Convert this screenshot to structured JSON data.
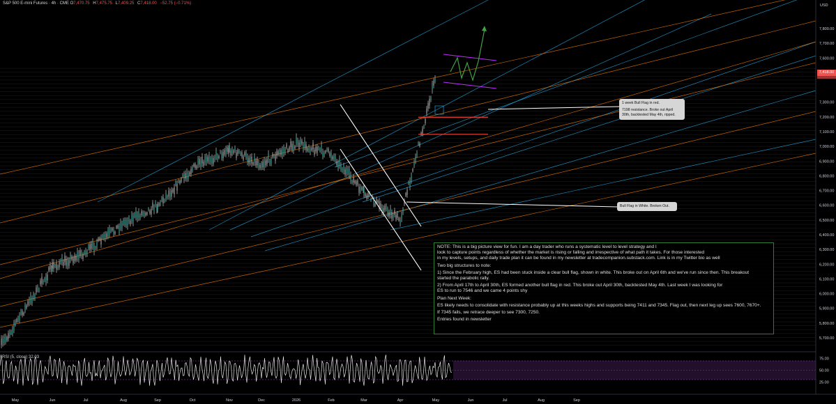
{
  "header": {
    "symbol": "S&P 500 E-mini Futures · 4h · CME",
    "o_label": "O",
    "o": "7,470.75",
    "h_label": "H",
    "h": "7,475.75",
    "l_label": "L",
    "l": "7,409.25",
    "c_label": "C",
    "c": "7,418.00",
    "chg": "−52.75 (−0.71%)"
  },
  "axis_currency": "USD",
  "price_tag": "7,418.00",
  "colors": {
    "background": "#000000",
    "candles": "#9e9e9e",
    "support_lines_orange": "#f57c00",
    "channel_lines_blue": "#29b6f6",
    "bull_flag_white": "#ffffff",
    "bull_flag_red": "#f44336",
    "projection_green": "#43a047",
    "flag_purple": "#c02bff",
    "rsi_band": "#5e2a7e",
    "negative": "#ef5350"
  },
  "callouts": {
    "red_flag": {
      "line1": "1 week Bull Flag in red.",
      "line2": "7198 resistance. Broke out April 30th, backtested May 4th, ripped."
    },
    "white_flag": {
      "line1": "Bull Flag in White. Broken Out."
    }
  },
  "note": {
    "p1": "NOTE: This is a big picture view for fun. I am a day trader who runs a systematic level to level strategy and I\nlook to capture points regardless of whether the market is rising or falling and irrespective of what path it takes. For those interested\nin my levels, setups, and daily trade plan it can be found in my newsletter at tradecompanion.substack.com. Link is in my Twitter bio as well",
    "p2": "Two big structures to note:",
    "p3": "1) Since the February high, ES had been stuck inside a clear bull flag, shown in white. This broke out on April 6th and we've run since then. This breakout\nstarted the parabolic rally.",
    "p4": "2) From April 17th to April 30th, ES formed another bull flag in red. This broke out April 30th, backtested May 4th. Last week I was looking for\nES to run to 7546 and we came 4 points shy",
    "p5": "Plan Next Week:",
    "p6": "ES likely needs to consolidate with resistance probably up at this weeks highs and supports being 7411 and 7345. Flag out, then next leg up sees 7600, 7670+.",
    "p7": "If 7345 fails, we retrace deeper to see 7300, 7250.",
    "p8": "Entries found in newsletter"
  },
  "rsi": {
    "label": "RSI (5, close)",
    "value": "32.03"
  },
  "chart_data": [
    {
      "type": "line",
      "title": "S&P 500 E-mini Futures · 4h · CME",
      "x_axis": {
        "categories": [
          "May",
          "Jun",
          "Jul",
          "Aug",
          "Sep",
          "Oct",
          "Nov",
          "Dec",
          "2026",
          "Feb",
          "Mar",
          "Apr",
          "May",
          "Jun",
          "Jul",
          "Aug",
          "Sep"
        ]
      },
      "y_axis": {
        "ticks": [
          "7,800.00",
          "7,700.00",
          "7,600.00",
          "7,500.00",
          "7,300.00",
          "7,200.00",
          "7,100.00",
          "7,000.00",
          "6,900.00",
          "6,800.00",
          "6,700.00",
          "6,600.00",
          "6,500.00",
          "6,400.00",
          "6,300.00",
          "6,200.00",
          "6,100.00",
          "6,000.00",
          "5,900.00",
          "5,800.00",
          "5,700.00"
        ],
        "ylim": [
          5650,
          7860
        ],
        "position": "right"
      },
      "series": [
        {
          "x": [
            "May",
            "Jun",
            "Jul",
            "Aug",
            "Sep",
            "Oct",
            "Nov",
            "Dec",
            "2026",
            "Feb",
            "Mar",
            "Apr",
            "May"
          ],
          "values": [
            5650,
            6180,
            6280,
            6480,
            6600,
            6850,
            6980,
            6880,
            7020,
            6950,
            6680,
            6500,
            7475
          ]
        }
      ],
      "levels": {
        "red_flag_top": 7198,
        "red_flag_bottom": 7082,
        "white_flag_breakout": 6580,
        "last_close": 7418,
        "supports": [
          7411,
          7345
        ],
        "targets": [
          7600,
          7670
        ]
      },
      "grid": false
    },
    {
      "type": "line",
      "title": "RSI (5, close)",
      "y_axis": {
        "ticks": [
          "75.00",
          "50.00",
          "25.00"
        ],
        "ylim": [
          15,
          85
        ],
        "position": "right"
      },
      "band": [
        30,
        70
      ],
      "last_value": 32.03
    }
  ]
}
